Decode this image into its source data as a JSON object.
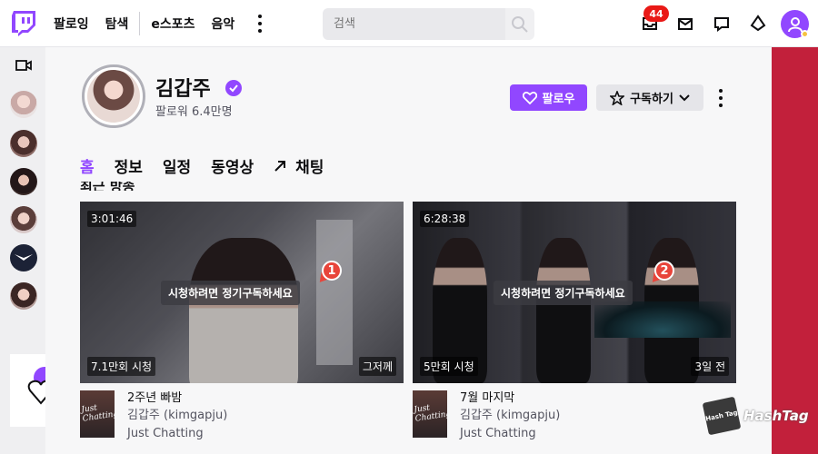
{
  "nav": {
    "items": [
      "팔로잉",
      "탐색",
      "e스포츠",
      "음악"
    ],
    "search_placeholder": "검색",
    "notification_count": "44"
  },
  "channel": {
    "name": "김갑주",
    "followers": "팔로워 6.4만명",
    "follow_label": "팔로우",
    "subscribe_label": "구독하기"
  },
  "tabs": [
    "홈",
    "정보",
    "일정",
    "동영상",
    "채팅"
  ],
  "section_title_partial": "최근 방송",
  "videos": [
    {
      "duration": "3:01:46",
      "views": "7.1만회 시청",
      "ago": "그저께",
      "overlay": "시청하려면 정기구독하세요",
      "marker": "1",
      "title": "2주년 빠밤",
      "channel": "김갑주 (kimgapju)",
      "category": "Just Chatting",
      "box_art_text": "Just Chatting"
    },
    {
      "duration": "6:28:38",
      "views": "5만회 시청",
      "ago": "3일 전",
      "overlay": "시청하려면 정기구독하세요",
      "marker": "2",
      "title": "7월 마지막",
      "channel": "김갑주 (kimgapju)",
      "category": "Just Chatting",
      "box_art_text": "Just Chatting"
    }
  ],
  "watermark": {
    "text": "HashTag",
    "box_text": "Hash Tag"
  },
  "colors": {
    "accent": "#9147ff",
    "badge": "#e91916",
    "marker": "#e8443a",
    "right_strip": "#c2203b"
  }
}
